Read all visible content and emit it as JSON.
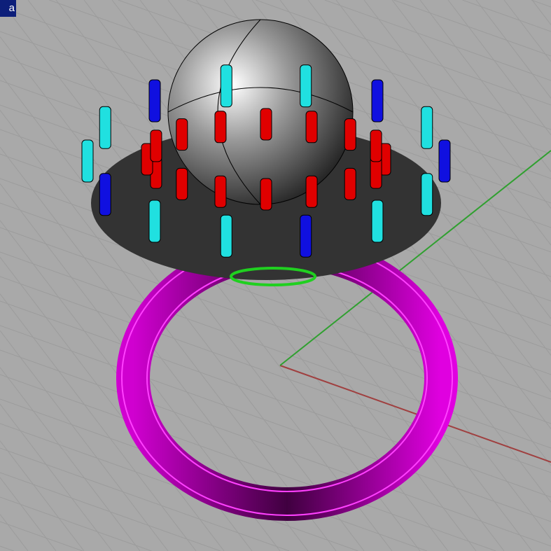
{
  "viewport": {
    "title_fragment": "a"
  },
  "colors": {
    "background": "#a9a9a9",
    "grid": "#9a9a9a",
    "band": "#e000e0",
    "prong_red": "#e00000",
    "prong_cyan": "#20e0e0",
    "prong_blue": "#1010e0",
    "axis_x": "#a04040",
    "axis_y": "#30a030"
  }
}
